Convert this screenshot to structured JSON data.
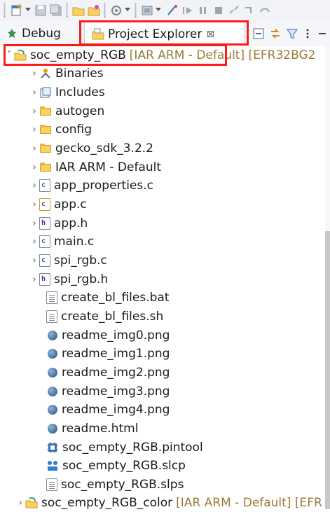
{
  "tabs": [
    {
      "label": "Debug"
    },
    {
      "label": "Project Explorer",
      "close": "⊠"
    }
  ],
  "tree": {
    "root": {
      "name": "soc_empty_RGB",
      "decoration": "[IAR ARM - Default] [EFR32BG2"
    },
    "children": [
      {
        "name": "Binaries"
      },
      {
        "name": "Includes"
      },
      {
        "name": "autogen"
      },
      {
        "name": "config"
      },
      {
        "name": "gecko_sdk_3.2.2"
      },
      {
        "name": "IAR ARM - Default"
      },
      {
        "name": "app_properties.c"
      },
      {
        "name": "app.c"
      },
      {
        "name": "app.h"
      },
      {
        "name": "main.c"
      },
      {
        "name": "spi_rgb.c"
      },
      {
        "name": "spi_rgb.h"
      },
      {
        "name": "create_bl_files.bat"
      },
      {
        "name": "create_bl_files.sh"
      },
      {
        "name": "readme_img0.png"
      },
      {
        "name": "readme_img1.png"
      },
      {
        "name": "readme_img2.png"
      },
      {
        "name": "readme_img3.png"
      },
      {
        "name": "readme_img4.png"
      },
      {
        "name": "readme.html"
      },
      {
        "name": "soc_empty_RGB.pintool"
      },
      {
        "name": "soc_empty_RGB.slcp"
      },
      {
        "name": "soc_empty_RGB.slps"
      }
    ],
    "next_project": {
      "name": "soc_empty_RGB_color",
      "decoration": "[IAR ARM - Default] [EFR"
    }
  },
  "colors": {
    "highlight": "#ff1a1a",
    "decoration": "#9b7b3a",
    "folder": "#ffd15c"
  },
  "icons": {
    "binaries": "binaries-icon",
    "includes": "includes-icon",
    "folder": "folder-icon",
    "c_file": "c-file-icon",
    "h_file": "h-file-icon",
    "text_file": "text-file-icon",
    "image_file": "image-file-icon",
    "pintool": "pintool-icon",
    "slcp": "slcp-icon",
    "project": "project-icon"
  }
}
